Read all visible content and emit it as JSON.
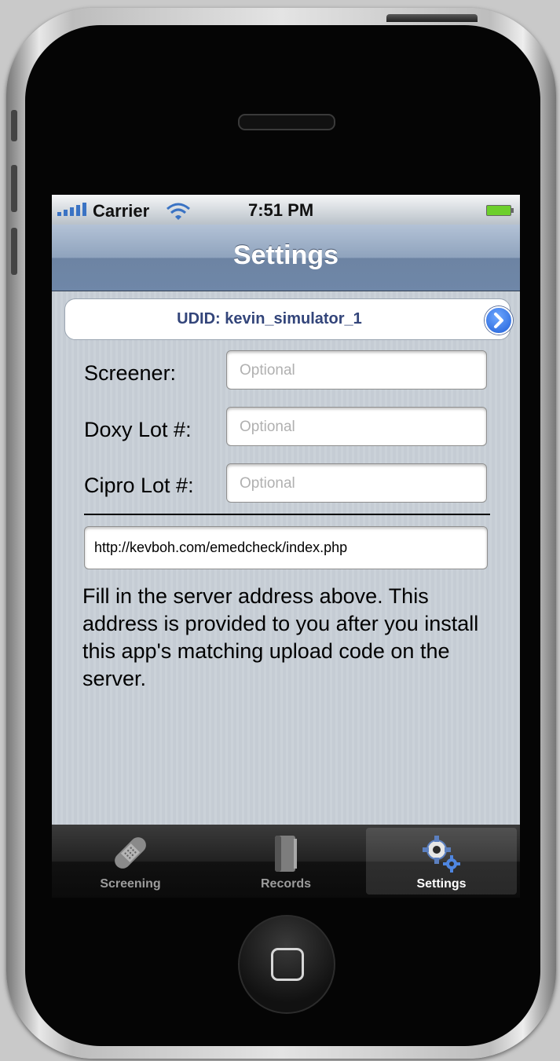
{
  "status_bar": {
    "carrier": "Carrier",
    "time": "7:51 PM"
  },
  "nav": {
    "title": "Settings"
  },
  "udid": {
    "text": "UDID: kevin_simulator_1"
  },
  "form": {
    "screener_label": "Screener:",
    "screener_placeholder": "Optional",
    "doxy_label": "Doxy Lot #:",
    "doxy_placeholder": "Optional",
    "cipro_label": "Cipro Lot #:",
    "cipro_placeholder": "Optional",
    "server_url": "http://kevboh.com/emedcheck/index.php"
  },
  "help_text": "Fill in the server address above. This address is provided to you after you install this app's matching upload code on the server.",
  "tabs": [
    {
      "label": "Screening",
      "icon": "bandage-icon",
      "selected": false
    },
    {
      "label": "Records",
      "icon": "book-icon",
      "selected": false
    },
    {
      "label": "Settings",
      "icon": "gears-icon",
      "selected": true
    }
  ],
  "colors": {
    "nav_bar": "#6f87a8",
    "udid_text": "#33457a",
    "disclosure_blue": "#1f5fd8",
    "battery_green": "#6ccf2c"
  }
}
